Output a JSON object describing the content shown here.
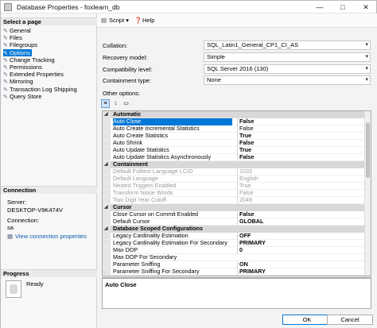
{
  "window": {
    "title": "Database Properties - foxlearn_db",
    "minimize": "—",
    "maximize": "□",
    "close": "✕"
  },
  "left": {
    "select_page": "Select a page",
    "pages": [
      {
        "label": "General",
        "icon": "page-icon"
      },
      {
        "label": "Files",
        "icon": "page-icon"
      },
      {
        "label": "Filegroups",
        "icon": "page-icon"
      },
      {
        "label": "Options",
        "icon": "page-icon",
        "selected": true
      },
      {
        "label": "Change Tracking",
        "icon": "page-icon"
      },
      {
        "label": "Permissions",
        "icon": "page-icon"
      },
      {
        "label": "Extended Properties",
        "icon": "page-icon"
      },
      {
        "label": "Mirroring",
        "icon": "page-icon"
      },
      {
        "label": "Transaction Log Shipping",
        "icon": "page-icon"
      },
      {
        "label": "Query Store",
        "icon": "page-icon"
      }
    ],
    "connection": {
      "heading": "Connection",
      "server_label": "Server:",
      "server_value": "DESKTOP-V9K474V",
      "connection_label": "Connection:",
      "connection_value": "sa",
      "view_link": "View connection properties"
    },
    "progress": {
      "heading": "Progress",
      "status": "Ready"
    }
  },
  "toolbar": {
    "script_label": "Script",
    "help_label": "Help"
  },
  "form": {
    "collation": {
      "label": "Collation:",
      "value": "SQL_Latin1_General_CP1_CI_AS"
    },
    "recovery": {
      "label": "Recovery model:",
      "value": "Simple"
    },
    "compat": {
      "label": "Compatibility level:",
      "value": "SQL Server 2016 (130)"
    },
    "containment": {
      "label": "Containment type:",
      "value": "None"
    },
    "other_options": "Other options:"
  },
  "grid": {
    "rows": [
      {
        "type": "cat",
        "name": "Automatic"
      },
      {
        "type": "prop",
        "name": "Auto Close",
        "value": "False",
        "selected": true,
        "bold": true
      },
      {
        "type": "prop",
        "name": "Auto Create Incremental Statistics",
        "value": "False"
      },
      {
        "type": "prop",
        "name": "Auto Create Statistics",
        "value": "True",
        "bold": true
      },
      {
        "type": "prop",
        "name": "Auto Shrink",
        "value": "False",
        "bold": true
      },
      {
        "type": "prop",
        "name": "Auto Update Statistics",
        "value": "True",
        "bold": true
      },
      {
        "type": "prop",
        "name": "Auto Update Statistics Asynchronously",
        "value": "False",
        "bold": true
      },
      {
        "type": "cat",
        "name": "Containment"
      },
      {
        "type": "prop",
        "name": "Default Fulltext Language LCID",
        "value": "1033",
        "disabled": true
      },
      {
        "type": "prop",
        "name": "Default Language",
        "value": "English",
        "disabled": true
      },
      {
        "type": "prop",
        "name": "Nested Triggers Enabled",
        "value": "True",
        "disabled": true
      },
      {
        "type": "prop",
        "name": "Transform Noise Words",
        "value": "False",
        "disabled": true
      },
      {
        "type": "prop",
        "name": "Two Digit Year Cutoff",
        "value": "2049",
        "disabled": true
      },
      {
        "type": "cat",
        "name": "Cursor"
      },
      {
        "type": "prop",
        "name": "Close Cursor on Commit Enabled",
        "value": "False",
        "bold": true
      },
      {
        "type": "prop",
        "name": "Default Cursor",
        "value": "GLOBAL",
        "bold": true
      },
      {
        "type": "cat",
        "name": "Database Scoped Configurations"
      },
      {
        "type": "prop",
        "name": "Legacy Cardinality Estimation",
        "value": "OFF",
        "bold": true
      },
      {
        "type": "prop",
        "name": "Legacy Cardinality Estimation For Secondary",
        "value": "PRIMARY",
        "bold": true
      },
      {
        "type": "prop",
        "name": "Max DOP",
        "value": "0",
        "bold": true
      },
      {
        "type": "prop",
        "name": "Max DOP For Secondary",
        "value": ""
      },
      {
        "type": "prop",
        "name": "Parameter Sniffing",
        "value": "ON",
        "bold": true
      },
      {
        "type": "prop",
        "name": "Parameter Sniffing For Secondary",
        "value": "PRIMARY",
        "bold": true
      }
    ]
  },
  "description": {
    "title": "Auto Close"
  },
  "buttons": {
    "ok": "OK",
    "cancel": "Cancel"
  }
}
